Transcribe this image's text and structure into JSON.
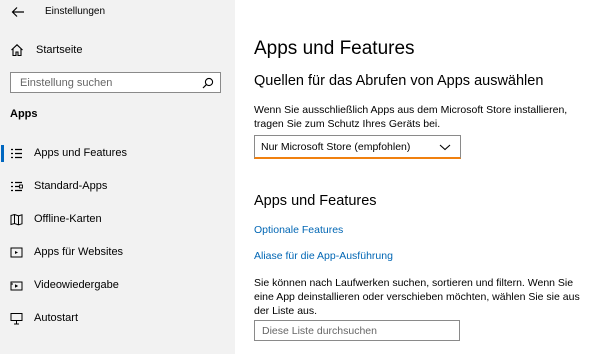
{
  "window": {
    "title": "Einstellungen"
  },
  "sidebar": {
    "home_label": "Startseite",
    "search_placeholder": "Einstellung suchen",
    "section_label": "Apps",
    "items": [
      {
        "label": "Apps und Features",
        "icon": "list-icon",
        "selected": true
      },
      {
        "label": "Standard-Apps",
        "icon": "default-apps-icon",
        "selected": false
      },
      {
        "label": "Offline-Karten",
        "icon": "map-icon",
        "selected": false
      },
      {
        "label": "Apps für Websites",
        "icon": "web-apps-icon",
        "selected": false
      },
      {
        "label": "Videowiedergabe",
        "icon": "video-icon",
        "selected": false
      },
      {
        "label": "Autostart",
        "icon": "startup-icon",
        "selected": false
      }
    ]
  },
  "main": {
    "title": "Apps und Features",
    "source_heading": "Quellen für das Abrufen von Apps auswählen",
    "source_description": "Wenn Sie ausschließlich Apps aus dem Microsoft Store installieren, tragen Sie zum Schutz Ihres Geräts bei.",
    "source_dropdown_value": "Nur Microsoft Store (empfohlen)",
    "features_heading": "Apps und Features",
    "optional_features_link": "Optionale Features",
    "alias_link": "Aliase für die App-Ausführung",
    "features_description": "Sie können nach Laufwerken suchen, sortieren und filtern. Wenn Sie eine App deinstallieren oder verschieben möchten, wählen Sie sie aus der Liste aus.",
    "list_search_placeholder": "Diese Liste durchsuchen"
  },
  "colors": {
    "accent": "#0067c0",
    "link": "#0066b4",
    "dropdown_underline": "#f0800f",
    "sidebar_bg": "#f2f2f2"
  }
}
